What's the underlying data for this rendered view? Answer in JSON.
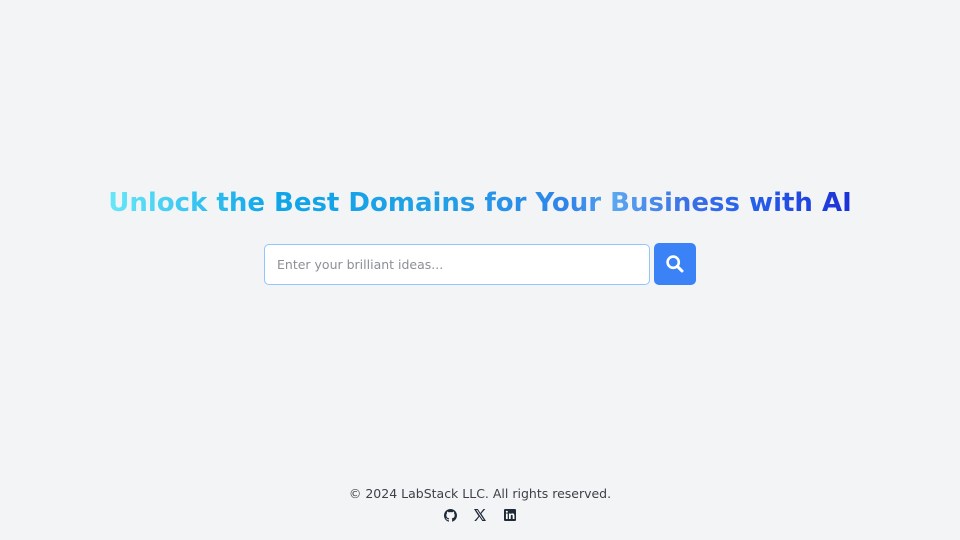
{
  "hero": {
    "headline": "Unlock the Best Domains for Your Business with AI",
    "search_placeholder": "Enter your brilliant ideas...",
    "search_icon": "search-icon"
  },
  "footer": {
    "copyright": "© 2024 LabStack LLC. All rights reserved.",
    "social_icons": [
      "github-icon",
      "x-icon",
      "linkedin-icon"
    ]
  },
  "colors": {
    "background": "#f3f4f6",
    "accent": "#3b82f6",
    "input_border": "#93c5fd",
    "gradient_start": "#67e8f9",
    "gradient_end": "#1e2fd6"
  }
}
